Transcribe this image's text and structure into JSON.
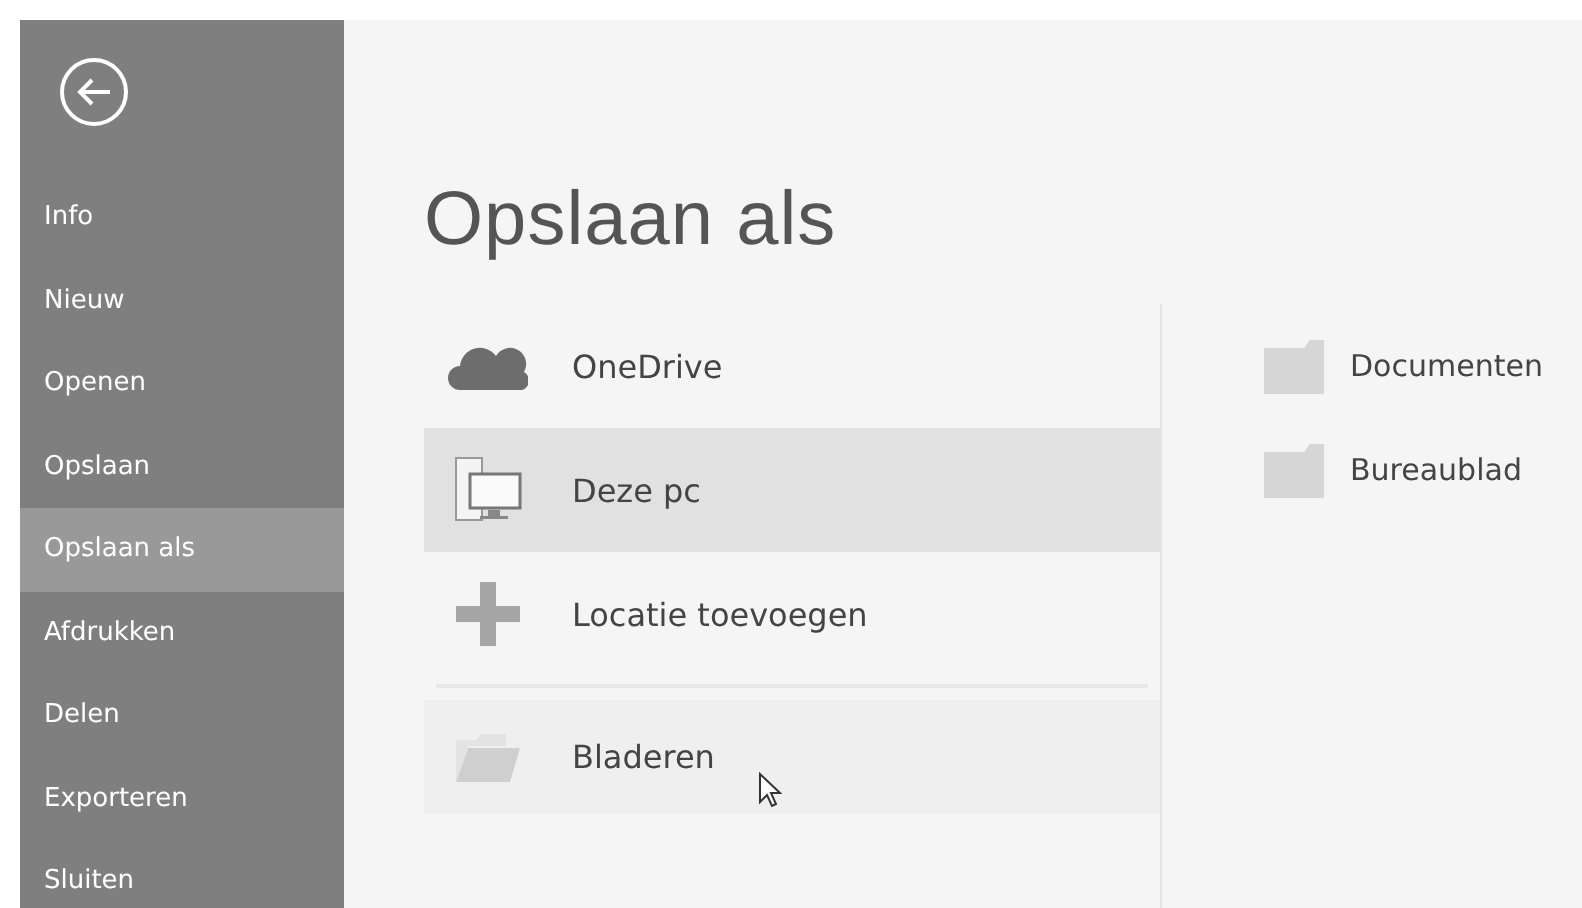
{
  "sidebar": {
    "items": [
      {
        "label": "Info",
        "selected": false
      },
      {
        "label": "Nieuw",
        "selected": false
      },
      {
        "label": "Openen",
        "selected": false
      },
      {
        "label": "Opslaan",
        "selected": false
      },
      {
        "label": "Opslaan als",
        "selected": true
      },
      {
        "label": "Afdrukken",
        "selected": false
      },
      {
        "label": "Delen",
        "selected": false
      },
      {
        "label": "Exporteren",
        "selected": false
      },
      {
        "label": "Sluiten",
        "selected": false
      }
    ]
  },
  "title": "Opslaan als",
  "locations": [
    {
      "kind": "cloud",
      "label": "OneDrive",
      "selected": false,
      "hovered": false,
      "separated": false
    },
    {
      "kind": "pc",
      "label": "Deze pc",
      "selected": true,
      "hovered": false,
      "separated": false
    },
    {
      "kind": "plus",
      "label": "Locatie toevoegen",
      "selected": false,
      "hovered": false,
      "separated": false
    },
    {
      "kind": "folder",
      "label": "Bladeren",
      "selected": false,
      "hovered": true,
      "separated": true
    }
  ],
  "folders": [
    {
      "label": "Documenten"
    },
    {
      "label": "Bureaublad"
    }
  ]
}
